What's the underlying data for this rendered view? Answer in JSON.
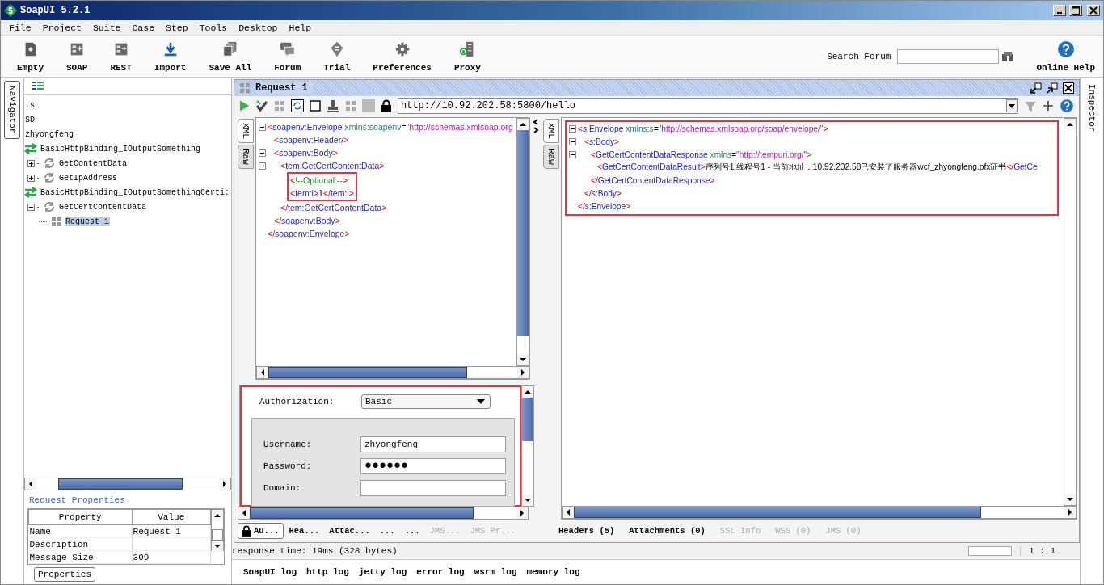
{
  "window": {
    "title": "SoapUI 5.2.1"
  },
  "menu": [
    {
      "label": "File",
      "mnemonic": true
    },
    {
      "label": "Project",
      "mnemonic": false
    },
    {
      "label": "Suite",
      "mnemonic": false
    },
    {
      "label": "Case",
      "mnemonic": false
    },
    {
      "label": "Step",
      "mnemonic": false
    },
    {
      "label": "Tools",
      "mnemonic": true
    },
    {
      "label": "Desktop",
      "mnemonic": true
    },
    {
      "label": "Help",
      "mnemonic": true
    }
  ],
  "toolbar": [
    {
      "label": "Empty"
    },
    {
      "label": "SOAP"
    },
    {
      "label": "REST"
    },
    {
      "label": "Import"
    },
    {
      "label": "Save All"
    },
    {
      "label": "Forum"
    },
    {
      "label": "Trial"
    },
    {
      "label": "Preferences"
    },
    {
      "label": "Proxy"
    }
  ],
  "search": {
    "label": "Search Forum"
  },
  "help": {
    "label": "Online Help"
  },
  "navigator": {
    "tab": "Navigator",
    "tree": [
      {
        "label": ".s",
        "selected": false
      },
      {
        "label": "SD",
        "selected": false
      },
      {
        "label": "zhyongfeng",
        "selected": false,
        "children": [
          {
            "label": "BasicHttpBinding_IOutputSomething",
            "kind": "interface",
            "selected": false,
            "children": [
              {
                "label": "GetContentData",
                "kind": "operation",
                "selected": false,
                "expanded": false
              },
              {
                "label": "GetIpAddress",
                "kind": "operation",
                "selected": false,
                "expanded": false
              }
            ]
          },
          {
            "label": "BasicHttpBinding_IOutputSomethingCerti:",
            "kind": "interface",
            "selected": false,
            "children": [
              {
                "label": "GetCertContentData",
                "kind": "operation",
                "selected": false,
                "expanded": true,
                "children": [
                  {
                    "label": "Request 1",
                    "kind": "request",
                    "selected": true
                  }
                ]
              }
            ]
          }
        ]
      }
    ]
  },
  "properties": {
    "title": "Request Properties",
    "columns": [
      "Property",
      "Value"
    ],
    "rows": [
      {
        "property": "Name",
        "value": "Request 1"
      },
      {
        "property": "Description"
      },
      {
        "property": "Message Size",
        "value": "309"
      }
    ],
    "button": "Properties"
  },
  "request": {
    "title": "Request 1",
    "url": "http://10.92.202.58:5800/hello",
    "editor_tabs": [
      {
        "label": "XML",
        "selected": true
      },
      {
        "label": "Raw",
        "selected": false
      }
    ],
    "xml": [
      {
        "line": [
          {
            "kind": "punct",
            "text": "<"
          },
          {
            "kind": "tag",
            "text": "soapenv:Envelope"
          },
          {
            "kind": "attr",
            "text": " xmlns:soapenv"
          },
          {
            "kind": "plain",
            "text": "="
          },
          {
            "kind": "value",
            "text": "\"http://schemas.xmlsoap.org"
          }
        ],
        "fold": true,
        "children": [
          {
            "line": [
              {
                "kind": "punct",
                "text": "<"
              },
              {
                "kind": "tag",
                "text": "soapenv:Header"
              },
              {
                "kind": "punct",
                "text": "/>"
              }
            ]
          },
          {
            "line": [
              {
                "kind": "punct",
                "text": "<"
              },
              {
                "kind": "tag",
                "text": "soapenv:Body"
              },
              {
                "kind": "punct",
                "text": ">"
              }
            ],
            "fold": true,
            "children": [
              {
                "line": [
                  {
                    "kind": "punct",
                    "text": "<"
                  },
                  {
                    "kind": "tag",
                    "text": "tem:GetCertContentData"
                  },
                  {
                    "kind": "punct",
                    "text": ">"
                  }
                ],
                "fold": true,
                "highlight": true,
                "children": [
                  {
                    "line": [
                      {
                        "kind": "punct",
                        "text": "<"
                      },
                      {
                        "kind": "comment",
                        "text": "!--Optional:--"
                      },
                      {
                        "kind": "punct",
                        "text": ">"
                      }
                    ]
                  },
                  {
                    "line": [
                      {
                        "kind": "punct",
                        "text": "<"
                      },
                      {
                        "kind": "tag",
                        "text": "tem:i"
                      },
                      {
                        "kind": "punct",
                        "text": ">"
                      },
                      {
                        "kind": "plain",
                        "text": "1"
                      },
                      {
                        "kind": "punct",
                        "text": "</"
                      },
                      {
                        "kind": "tag",
                        "text": "tem:i"
                      },
                      {
                        "kind": "punct",
                        "text": ">"
                      }
                    ]
                  }
                ],
                "end": [
                  {
                    "kind": "punct",
                    "text": "</"
                  },
                  {
                    "kind": "tag",
                    "text": "tem:GetCertContentData"
                  },
                  {
                    "kind": "punct",
                    "text": ">"
                  }
                ]
              }
            ],
            "end": [
              {
                "kind": "punct",
                "text": "</"
              },
              {
                "kind": "tag",
                "text": "soapenv:Body"
              },
              {
                "kind": "punct",
                "text": ">"
              }
            ]
          }
        ],
        "end": [
          {
            "kind": "punct",
            "text": "</"
          },
          {
            "kind": "tag",
            "text": "soapenv:Envelope"
          },
          {
            "kind": "punct",
            "text": ">"
          }
        ]
      }
    ],
    "auth": {
      "highlight": true,
      "type_label": "Authorization:",
      "type": "Basic",
      "fields": [
        {
          "label": "Username:",
          "value": "zhyongfeng"
        },
        {
          "label": "Password:",
          "value": "●●●●●●"
        },
        {
          "label": "Domain:"
        }
      ]
    },
    "tabs": [
      {
        "label": "Au...",
        "selected": true,
        "disabled": false
      },
      {
        "label": "Hea...",
        "selected": false,
        "disabled": false
      },
      {
        "label": "Attac...",
        "selected": false,
        "disabled": false
      },
      {
        "label": "...",
        "selected": false,
        "disabled": false
      },
      {
        "label": "...",
        "selected": false,
        "disabled": false
      },
      {
        "label": "JMS...",
        "selected": false,
        "disabled": true
      },
      {
        "label": "JMS Pr...",
        "selected": false,
        "disabled": true
      }
    ]
  },
  "response": {
    "highlight": true,
    "editor_tabs": [
      {
        "label": "XML",
        "selected": true
      },
      {
        "label": "Raw",
        "selected": false
      }
    ],
    "xml": [
      {
        "line": [
          {
            "kind": "punct",
            "text": "<"
          },
          {
            "kind": "tag",
            "text": "s:Envelope"
          },
          {
            "kind": "attr",
            "text": " xmlns:s"
          },
          {
            "kind": "plain",
            "text": "="
          },
          {
            "kind": "value",
            "text": "\"http://schemas.xmlsoap.org/soap/envelope/\""
          },
          {
            "kind": "punct",
            "text": ">"
          }
        ],
        "fold": true,
        "children": [
          {
            "line": [
              {
                "kind": "punct",
                "text": "<"
              },
              {
                "kind": "tag",
                "text": "s:Body"
              },
              {
                "kind": "punct",
                "text": ">"
              }
            ],
            "fold": true,
            "children": [
              {
                "line": [
                  {
                    "kind": "punct",
                    "text": "<"
                  },
                  {
                    "kind": "tag",
                    "text": "GetCertContentDataResponse"
                  },
                  {
                    "kind": "attr",
                    "text": " xmlns"
                  },
                  {
                    "kind": "plain",
                    "text": "="
                  },
                  {
                    "kind": "value",
                    "text": "\"http://tempuri.org/\""
                  },
                  {
                    "kind": "punct",
                    "text": ">"
                  }
                ],
                "fold": true,
                "children": [
                  {
                    "line": [
                      {
                        "kind": "punct",
                        "text": "<"
                      },
                      {
                        "kind": "tag",
                        "text": "GetCertContentDataResult"
                      },
                      {
                        "kind": "punct",
                        "text": ">"
                      },
                      {
                        "kind": "plain",
                        "text": "序列号1,线程号1 - 当前地址：10.92.202.58已安装了服务器wcf_zhyongfeng.pfx证书"
                      },
                      {
                        "kind": "punct",
                        "text": "</"
                      },
                      {
                        "kind": "tag",
                        "text": "GetCe"
                      }
                    ]
                  }
                ],
                "end": [
                  {
                    "kind": "punct",
                    "text": "</"
                  },
                  {
                    "kind": "tag",
                    "text": "GetCertContentDataResponse"
                  },
                  {
                    "kind": "punct",
                    "text": ">"
                  }
                ]
              }
            ],
            "end": [
              {
                "kind": "punct",
                "text": "</"
              },
              {
                "kind": "tag",
                "text": "s:Body"
              },
              {
                "kind": "punct",
                "text": ">"
              }
            ]
          }
        ],
        "end": [
          {
            "kind": "punct",
            "text": "</"
          },
          {
            "kind": "tag",
            "text": "s:Envelope"
          },
          {
            "kind": "punct",
            "text": ">"
          }
        ]
      }
    ],
    "tabs": [
      {
        "label": "Headers (5)",
        "disabled": false
      },
      {
        "label": "Attachments (0)",
        "disabled": false
      },
      {
        "label": "SSL Info",
        "disabled": true
      },
      {
        "label": "WSS (0)",
        "disabled": true
      },
      {
        "label": "JMS (0)",
        "disabled": true
      }
    ],
    "position": "1 : 1"
  },
  "status": "response time: 19ms (328 bytes)",
  "logs": [
    "SoapUI log",
    "http log",
    "jetty log",
    "error log",
    "wsrm log",
    "memory log"
  ],
  "inspector": {
    "tab": "Inspector"
  }
}
